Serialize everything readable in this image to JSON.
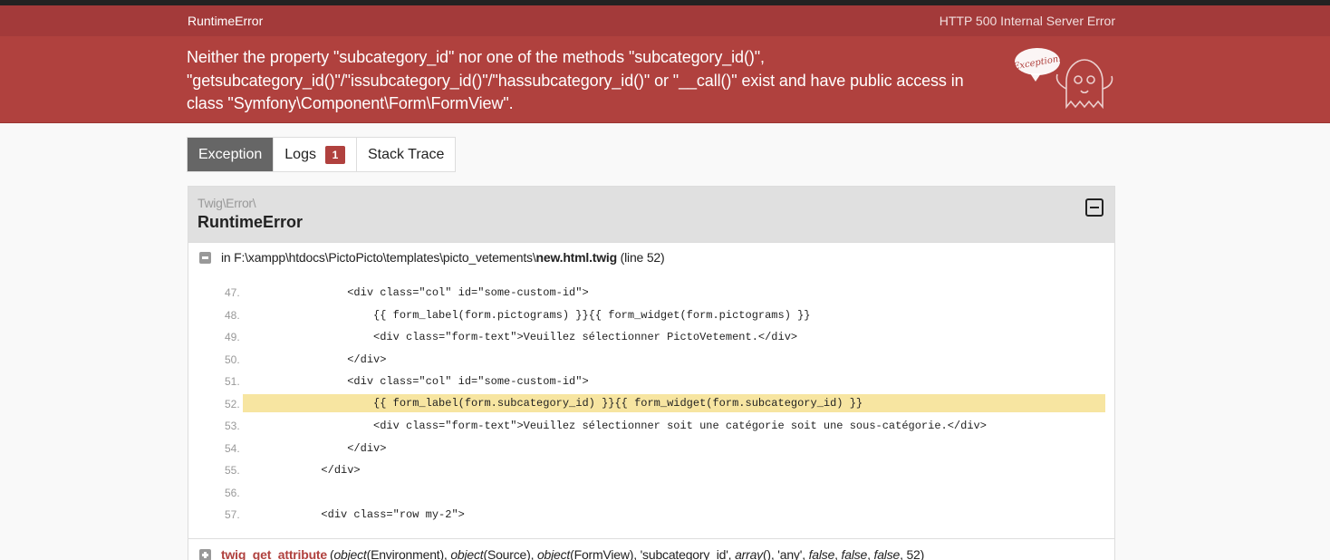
{
  "header": {
    "exception_class_short": "RuntimeError",
    "status": "HTTP 500 Internal Server Error"
  },
  "message": "Neither the property \"subcategory_id\" nor one of the methods \"subcategory_id()\", \"getsubcategory_id()\"/\"issubcategory_id()\"/\"hassubcategory_id()\" or \"__call()\" exist and have public access in class \"Symfony\\Component\\Form\\FormView\".",
  "ghost": {
    "bubble_text": "Exception!"
  },
  "tabs": [
    {
      "label": "Exception",
      "active": true
    },
    {
      "label": "Logs",
      "badge": "1"
    },
    {
      "label": "Stack Trace"
    }
  ],
  "exception": {
    "namespace": "Twig\\Error\\",
    "class": "RuntimeError",
    "file_prefix": "in F:\\xampp\\htdocs\\PictoPicto\\templates\\picto_vetements\\",
    "file_name": "new.html.twig",
    "file_line": "(line 52)"
  },
  "code": [
    {
      "num": "47.",
      "text": "                <div class=\"col\" id=\"some-custom-id\">"
    },
    {
      "num": "48.",
      "text": "                    {{ form_label(form.pictograms) }}{{ form_widget(form.pictograms) }}"
    },
    {
      "num": "49.",
      "text": "                    <div class=\"form-text\">Veuillez sélectionner PictoVetement.</div>"
    },
    {
      "num": "50.",
      "text": "                </div>"
    },
    {
      "num": "51.",
      "text": "                <div class=\"col\" id=\"some-custom-id\">"
    },
    {
      "num": "52.",
      "text": "                    {{ form_label(form.subcategory_id) }}{{ form_widget(form.subcategory_id) }}",
      "highlight": true
    },
    {
      "num": "53.",
      "text": "                    <div class=\"form-text\">Veuillez sélectionner soit une catégorie soit une sous-catégorie.</div>"
    },
    {
      "num": "54.",
      "text": "                </div>"
    },
    {
      "num": "55.",
      "text": "            </div>"
    },
    {
      "num": "56.",
      "text": ""
    },
    {
      "num": "57.",
      "text": "            <div class=\"row my-2\">"
    }
  ],
  "trace": {
    "function": "twig_get_attribute",
    "args_html_parts": [
      "(",
      {
        "i": "object"
      },
      "(Environment), ",
      {
        "i": "object"
      },
      "(Source), ",
      {
        "i": "object"
      },
      "(FormView), 'subcategory_id', ",
      {
        "i": "array"
      },
      "(), 'any', ",
      {
        "i": "false"
      },
      ", ",
      {
        "i": "false"
      },
      ", ",
      {
        "i": "false"
      },
      ", 52)"
    ]
  }
}
